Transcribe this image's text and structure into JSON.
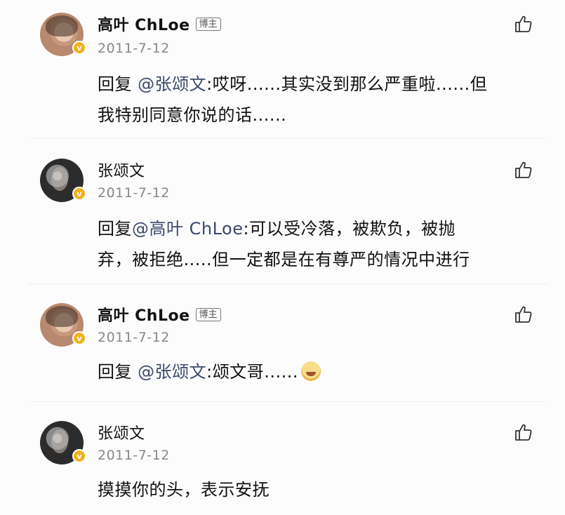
{
  "comments": [
    {
      "user": "高叶 ChLoe",
      "badge": "博主",
      "date": "2011-7-12",
      "reply_prefix": "回复 ",
      "mention": "@张颂文",
      "text_line1_rest": ":哎呀......其实没到那么严重啦......但",
      "text_line2": "我特别同意你说的话......",
      "avatar": "female-avatar",
      "verified": "v"
    },
    {
      "user": "张颂文",
      "date": "2011-7-12",
      "reply_prefix": "回复",
      "mention": "@高叶 ChLoe",
      "text_line1_rest": ":可以受冷落，被欺负，被抛",
      "text_line2": "弃，被拒绝.....但一定都是在有尊严的情况中进行",
      "avatar": "male-avatar",
      "verified": "v"
    },
    {
      "user": "高叶 ChLoe",
      "badge": "博主",
      "date": "2011-7-12",
      "reply_prefix": "回复 ",
      "mention": "@张颂文",
      "text_line1_rest": ":颂文哥......",
      "emoji": "crying-face-emoji",
      "avatar": "female-avatar",
      "verified": "v"
    },
    {
      "user": "张颂文",
      "date": "2011-7-12",
      "text_line1": "摸摸你的头，表示安抚",
      "avatar": "male-avatar",
      "verified": "v"
    }
  ],
  "icons": {
    "like": "thumbs-up-outline-icon",
    "verified": "verified-v-badge-icon"
  },
  "colors": {
    "mention": "#3a4a6a",
    "date": "#888888",
    "verified_badge": "#f2b21c"
  }
}
